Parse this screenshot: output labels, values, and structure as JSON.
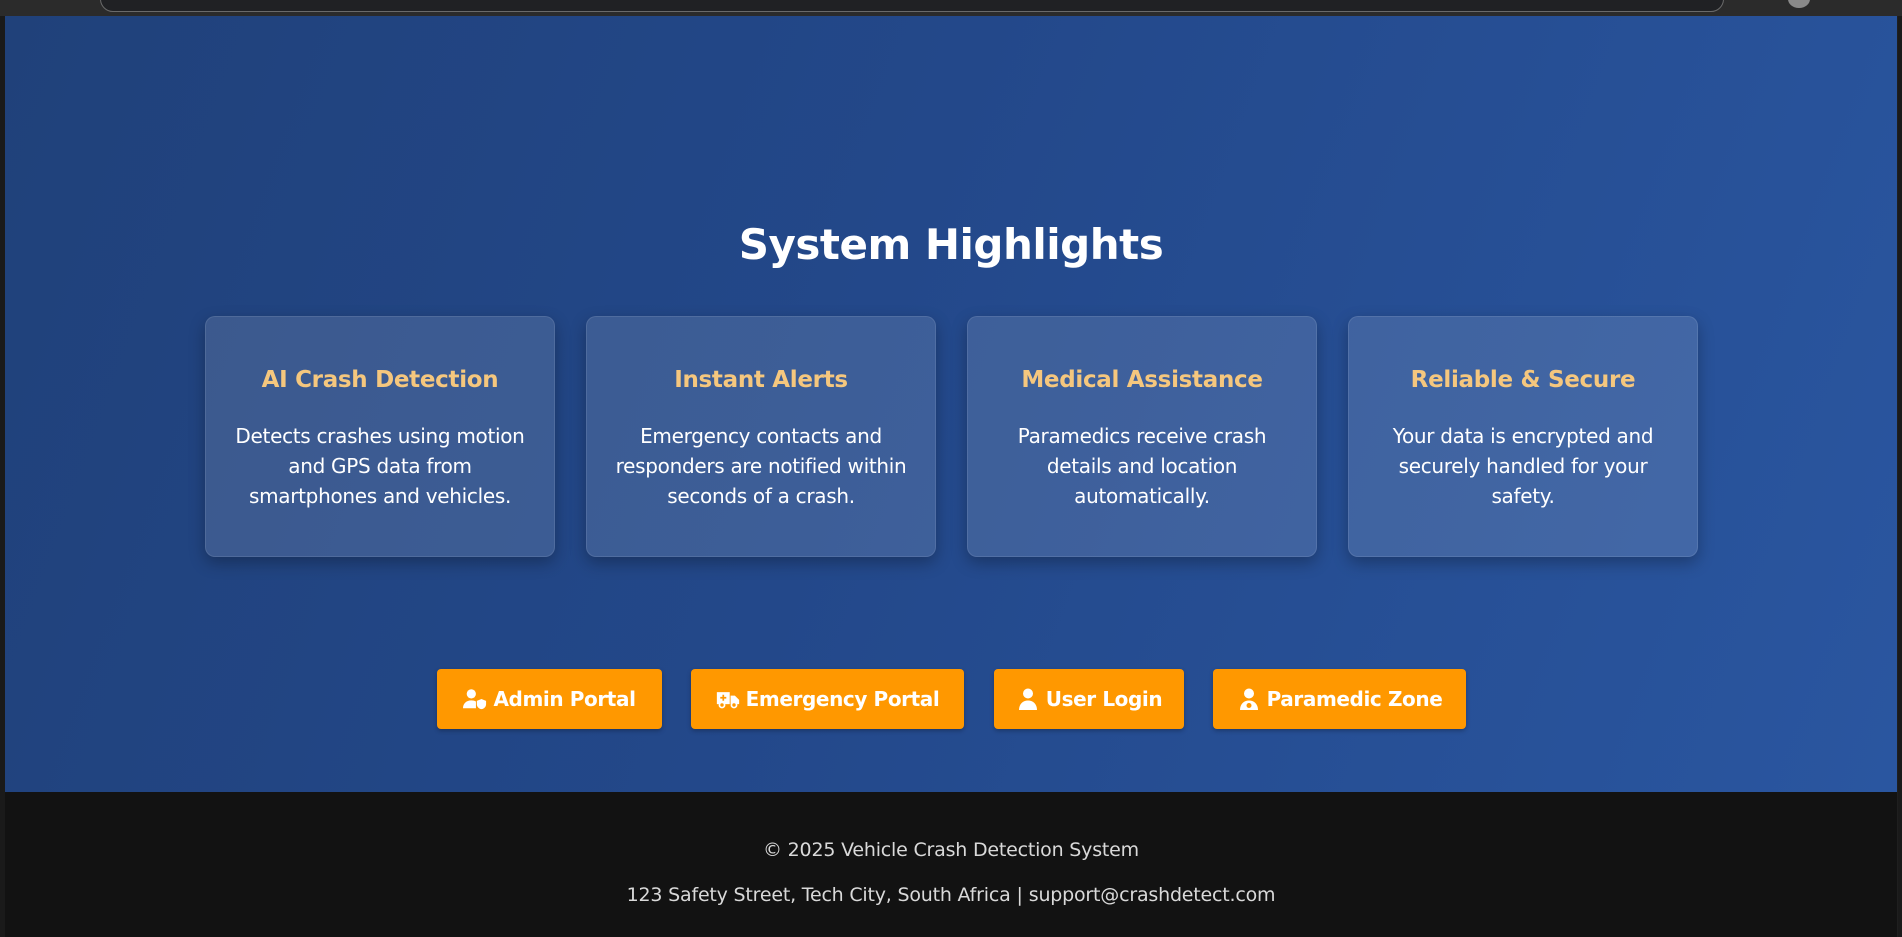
{
  "section_title": "System Highlights",
  "cards": [
    {
      "title": "AI Crash Detection",
      "text": "Detects crashes using motion and GPS data from smartphones and vehicles."
    },
    {
      "title": "Instant Alerts",
      "text": "Emergency contacts and responders are notified within seconds of a crash."
    },
    {
      "title": "Medical Assistance",
      "text": "Paramedics receive crash details and location automatically."
    },
    {
      "title": "Reliable & Secure",
      "text": "Your data is encrypted and securely handled for your safety."
    }
  ],
  "buttons": [
    {
      "label": "Admin Portal",
      "icon": "user-shield-icon"
    },
    {
      "label": "Emergency Portal",
      "icon": "ambulance-icon"
    },
    {
      "label": "User Login",
      "icon": "user-icon"
    },
    {
      "label": "Paramedic Zone",
      "icon": "user-doctor-icon"
    }
  ],
  "footer": {
    "copyright": "© 2025 Vehicle Crash Detection System",
    "address": "123 Safety Street, Tech City, South Africa",
    "separator": "|",
    "email": "support@crashdetect.com"
  },
  "colors": {
    "accent": "#ff9800",
    "card_title": "#f5c77e",
    "background_start": "#20417a",
    "background_end": "#2a56a0",
    "footer_bg": "#121212"
  }
}
